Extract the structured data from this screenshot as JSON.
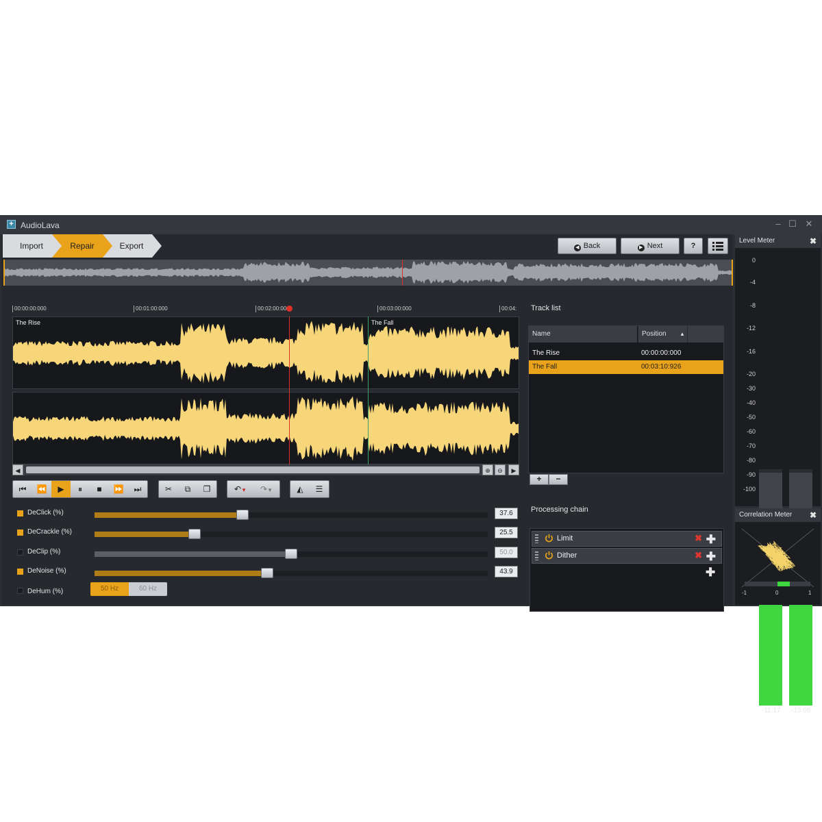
{
  "app": {
    "title": "AudioLava"
  },
  "window_controls": {
    "minimize": "–",
    "maximize": "☐",
    "close": "✕"
  },
  "steps": [
    {
      "label": "Import"
    },
    {
      "label": "Repair"
    },
    {
      "label": "Export"
    }
  ],
  "nav": {
    "back_label": "Back",
    "next_label": "Next",
    "help_label": "?"
  },
  "ruler": [
    "00:00:00:000",
    "00:01:00:000",
    "00:02:00:00",
    "00:03:00:000",
    "00:04:"
  ],
  "tracks_on_wave": [
    "The Rise",
    "The Fall"
  ],
  "tracklist": {
    "title": "Track list",
    "columns": [
      "Name",
      "Position"
    ],
    "rows": [
      {
        "name": "The Rise",
        "position": "00:00:00:000",
        "selected": false
      },
      {
        "name": "The Fall",
        "position": "00:03:10:926",
        "selected": true
      }
    ],
    "add_label": "+",
    "remove_label": "−"
  },
  "params": [
    {
      "label": "DeClick (%)",
      "enabled": true,
      "value": "37.6",
      "fraction": 0.376
    },
    {
      "label": "DeCrackle (%)",
      "enabled": true,
      "value": "25.5",
      "fraction": 0.255
    },
    {
      "label": "DeClip (%)",
      "enabled": false,
      "value": "50.0",
      "fraction": 0.5
    },
    {
      "label": "DeNoise (%)",
      "enabled": true,
      "value": "43.9",
      "fraction": 0.439
    },
    {
      "label": "DeHum (%)",
      "enabled": false,
      "options": [
        "50 Hz",
        "60 Hz"
      ],
      "selected": "50 Hz"
    }
  ],
  "processing_chain": {
    "title": "Processing chain",
    "items": [
      {
        "name": "Limit"
      },
      {
        "name": "Dither"
      }
    ]
  },
  "level_meter": {
    "title": "Level Meter",
    "scale": [
      "0",
      "-4",
      "-8",
      "-12",
      "-16",
      "-20",
      "-30",
      "-40",
      "-50",
      "-60",
      "-70",
      "-80",
      "-90",
      "-100"
    ],
    "left_value": "-11.17",
    "right_value": "-13.06"
  },
  "correlation_meter": {
    "title": "Correlation Meter",
    "scale": [
      "-1",
      "0",
      "1"
    ]
  },
  "colors": {
    "accent": "#e8a31a",
    "waveform": "#f7d67a",
    "meter_green": "#3fd640",
    "playhead": "#e0302a",
    "track_marker": "#3fa06a"
  }
}
